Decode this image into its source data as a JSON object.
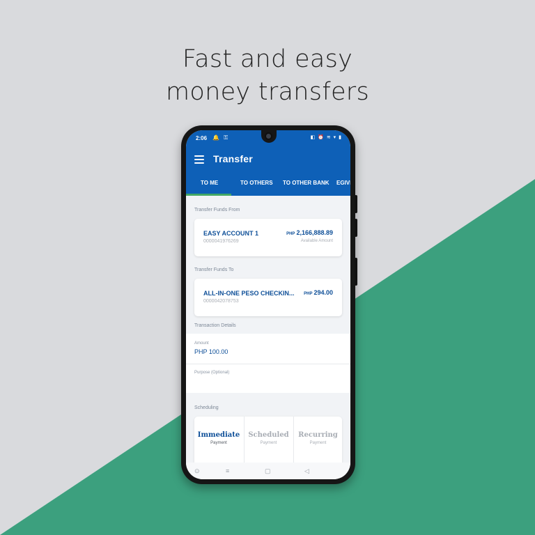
{
  "headline": {
    "line1": "Fast and easy",
    "line2": "money transfers"
  },
  "colors": {
    "brand_blue": "#0e60b7",
    "accent_green": "#3ca07e",
    "tab_indicator": "#42a766"
  },
  "status_bar": {
    "time": "2:06",
    "left_icons": "🔔 ⚿",
    "right_icons": "◧ ⏰ ≋ ▾ ▮"
  },
  "app_bar": {
    "title": "Transfer",
    "menu_icon": "hamburger-icon"
  },
  "tabs": [
    {
      "label": "TO ME",
      "active": true
    },
    {
      "label": "TO OTHERS",
      "active": false
    },
    {
      "label": "TO OTHER BANK",
      "active": false
    },
    {
      "label": "EGIVE",
      "active": false
    }
  ],
  "transfer_from": {
    "section_label": "Transfer Funds From",
    "account_name": "EASY ACCOUNT 1",
    "account_number": "0000041976269",
    "currency": "PHP",
    "amount": "2,166,888.89",
    "amount_caption": "Available Amount"
  },
  "transfer_to": {
    "section_label": "Transfer Funds To",
    "account_name": "ALL-IN-ONE PESO CHECKIN...",
    "account_number": "0000042078753",
    "currency": "PHP",
    "amount": "294.00"
  },
  "transaction_details": {
    "section_label": "Transaction Details",
    "amount_label": "Amount",
    "amount_value": "PHP 100.00",
    "purpose_label": "Purpose (Optional)",
    "purpose_value": ""
  },
  "scheduling": {
    "section_label": "Scheduling",
    "options": [
      {
        "title": "Immediate",
        "subtitle": "Payment",
        "selected": true
      },
      {
        "title": "Scheduled",
        "subtitle": "Payment",
        "selected": false
      },
      {
        "title": "Recurring",
        "subtitle": "Payment",
        "selected": false
      }
    ]
  },
  "nav_bar": {
    "accessibility": "⊙",
    "recents": "≡",
    "home": "▢",
    "back": "◁"
  }
}
